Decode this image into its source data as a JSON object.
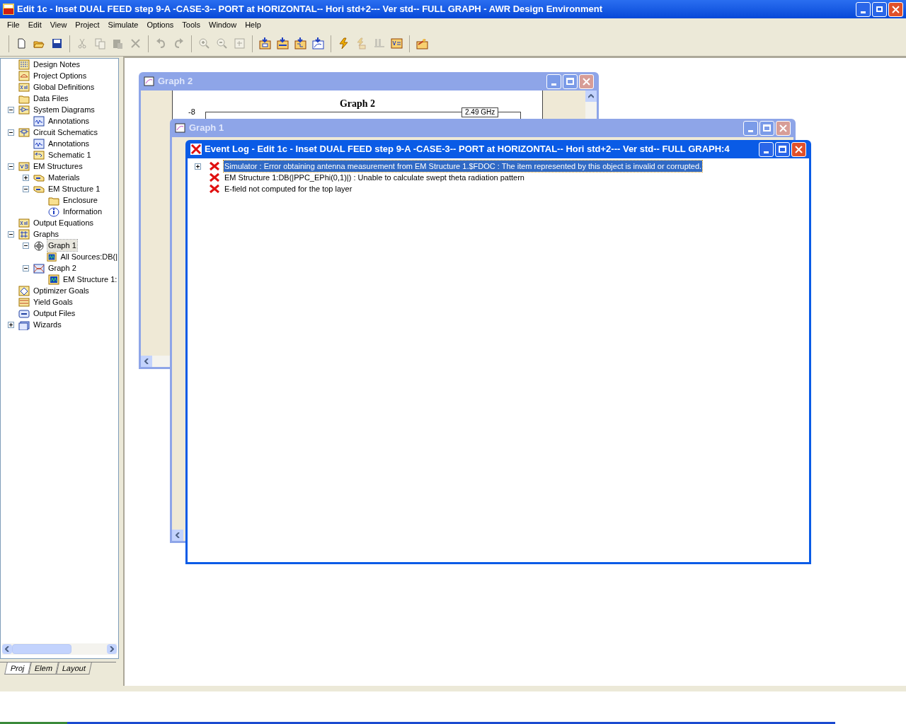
{
  "window": {
    "title": "Edit 1c - Inset DUAL  FEED step 9-A  -CASE-3-- PORT at HORIZONTAL-- Hori std+2--- Ver std-- FULL GRAPH - AWR Design Environment"
  },
  "menu": [
    "File",
    "Edit",
    "View",
    "Project",
    "Simulate",
    "Options",
    "Tools",
    "Window",
    "Help"
  ],
  "toolbar": [
    [
      {
        "kind": "new",
        "disabled": false
      },
      {
        "kind": "open",
        "disabled": false
      },
      {
        "kind": "save",
        "disabled": false
      }
    ],
    [
      {
        "kind": "cut",
        "disabled": true
      },
      {
        "kind": "copy",
        "disabled": true
      },
      {
        "kind": "paste",
        "disabled": true
      },
      {
        "kind": "delete",
        "disabled": true
      }
    ],
    [
      {
        "kind": "undo",
        "disabled": true
      },
      {
        "kind": "redo",
        "disabled": true
      }
    ],
    [
      {
        "kind": "zoomin",
        "disabled": true
      },
      {
        "kind": "zoomout",
        "disabled": true
      },
      {
        "kind": "fit",
        "disabled": true
      }
    ],
    [
      {
        "kind": "addsystem",
        "disabled": false
      },
      {
        "kind": "addcircuit",
        "disabled": false
      },
      {
        "kind": "addem",
        "disabled": false
      },
      {
        "kind": "addgraph",
        "disabled": false
      }
    ],
    [
      {
        "kind": "simulate",
        "disabled": false
      },
      {
        "kind": "tune",
        "disabled": true
      },
      {
        "kind": "step",
        "disabled": true
      },
      {
        "kind": "variables",
        "disabled": false
      }
    ],
    [
      {
        "kind": "wizard",
        "disabled": false
      }
    ]
  ],
  "project_tree": [
    {
      "label": "Design Notes",
      "kind": "notes",
      "selected": false
    },
    {
      "label": "Project Options",
      "kind": "options",
      "selected": false
    },
    {
      "label": "Global Definitions",
      "kind": "equation",
      "selected": false
    },
    {
      "label": "Data Files",
      "kind": "folder",
      "selected": false
    },
    {
      "label": "System Diagrams",
      "kind": "system",
      "selected": false,
      "expanded": true,
      "children": [
        {
          "label": "Annotations",
          "kind": "annotation",
          "selected": false
        }
      ]
    },
    {
      "label": "Circuit Schematics",
      "kind": "circuit",
      "selected": false,
      "expanded": true,
      "children": [
        {
          "label": "Annotations",
          "kind": "annotation",
          "selected": false
        },
        {
          "label": "Schematic 1",
          "kind": "schematic",
          "selected": false
        }
      ]
    },
    {
      "label": "EM Structures",
      "kind": "em",
      "selected": false,
      "expanded": true,
      "children": [
        {
          "label": "Materials",
          "kind": "layers",
          "selected": false,
          "expanded": false
        },
        {
          "label": "EM Structure 1",
          "kind": "layers",
          "selected": false,
          "expanded": true,
          "children": [
            {
              "label": "Enclosure",
              "kind": "folder",
              "selected": false
            },
            {
              "label": "Information",
              "kind": "info",
              "selected": false
            }
          ]
        }
      ]
    },
    {
      "label": "Output Equations",
      "kind": "equation",
      "selected": false
    },
    {
      "label": "Graphs",
      "kind": "grid",
      "selected": false,
      "expanded": true,
      "children": [
        {
          "label": "Graph 1",
          "kind": "polar",
          "selected": true,
          "expanded": true,
          "children": [
            {
              "label": "All Sources:DB(|",
              "kind": "trace",
              "selected": false
            }
          ]
        },
        {
          "label": "Graph 2",
          "kind": "smith",
          "selected": false,
          "expanded": true,
          "children": [
            {
              "label": "EM Structure 1:",
              "kind": "trace",
              "selected": false
            }
          ]
        }
      ]
    },
    {
      "label": "Optimizer Goals",
      "kind": "diamond",
      "selected": false
    },
    {
      "label": "Yield Goals",
      "kind": "yield",
      "selected": false
    },
    {
      "label": "Output Files",
      "kind": "output",
      "selected": false
    },
    {
      "label": "Wizards",
      "kind": "wizard",
      "selected": false,
      "expanded": false
    }
  ],
  "panel_tabs": [
    {
      "label": "Proj",
      "selected": true
    },
    {
      "label": "Elem",
      "selected": false
    },
    {
      "label": "Layout",
      "selected": false
    }
  ],
  "graph_2_window": {
    "title": "Graph 2",
    "graph_title": "Graph 2",
    "y_tick": "-8",
    "marker": "2.49 GHz"
  },
  "graph_1_window": {
    "title": "Graph 1"
  },
  "event_log": {
    "title": "Event Log - Edit 1c - Inset DUAL  FEED step 9-A  -CASE-3-- PORT at HORIZONTAL-- Hori std+2--- Ver std-- FULL GRAPH:4",
    "entries": [
      {
        "text": "Simulator : Error obtaining antenna measurement from EM Structure 1.$FDOC : The item represented by this object is invalid or corrupted.",
        "selected": true,
        "expanded": false
      },
      {
        "text": "EM Structure 1:DB(|PPC_EPhi(0,1)|) : Unable to calculate swept theta radiation pattern",
        "selected": false
      },
      {
        "text": "E-field not computed for the top layer",
        "selected": false
      }
    ]
  }
}
